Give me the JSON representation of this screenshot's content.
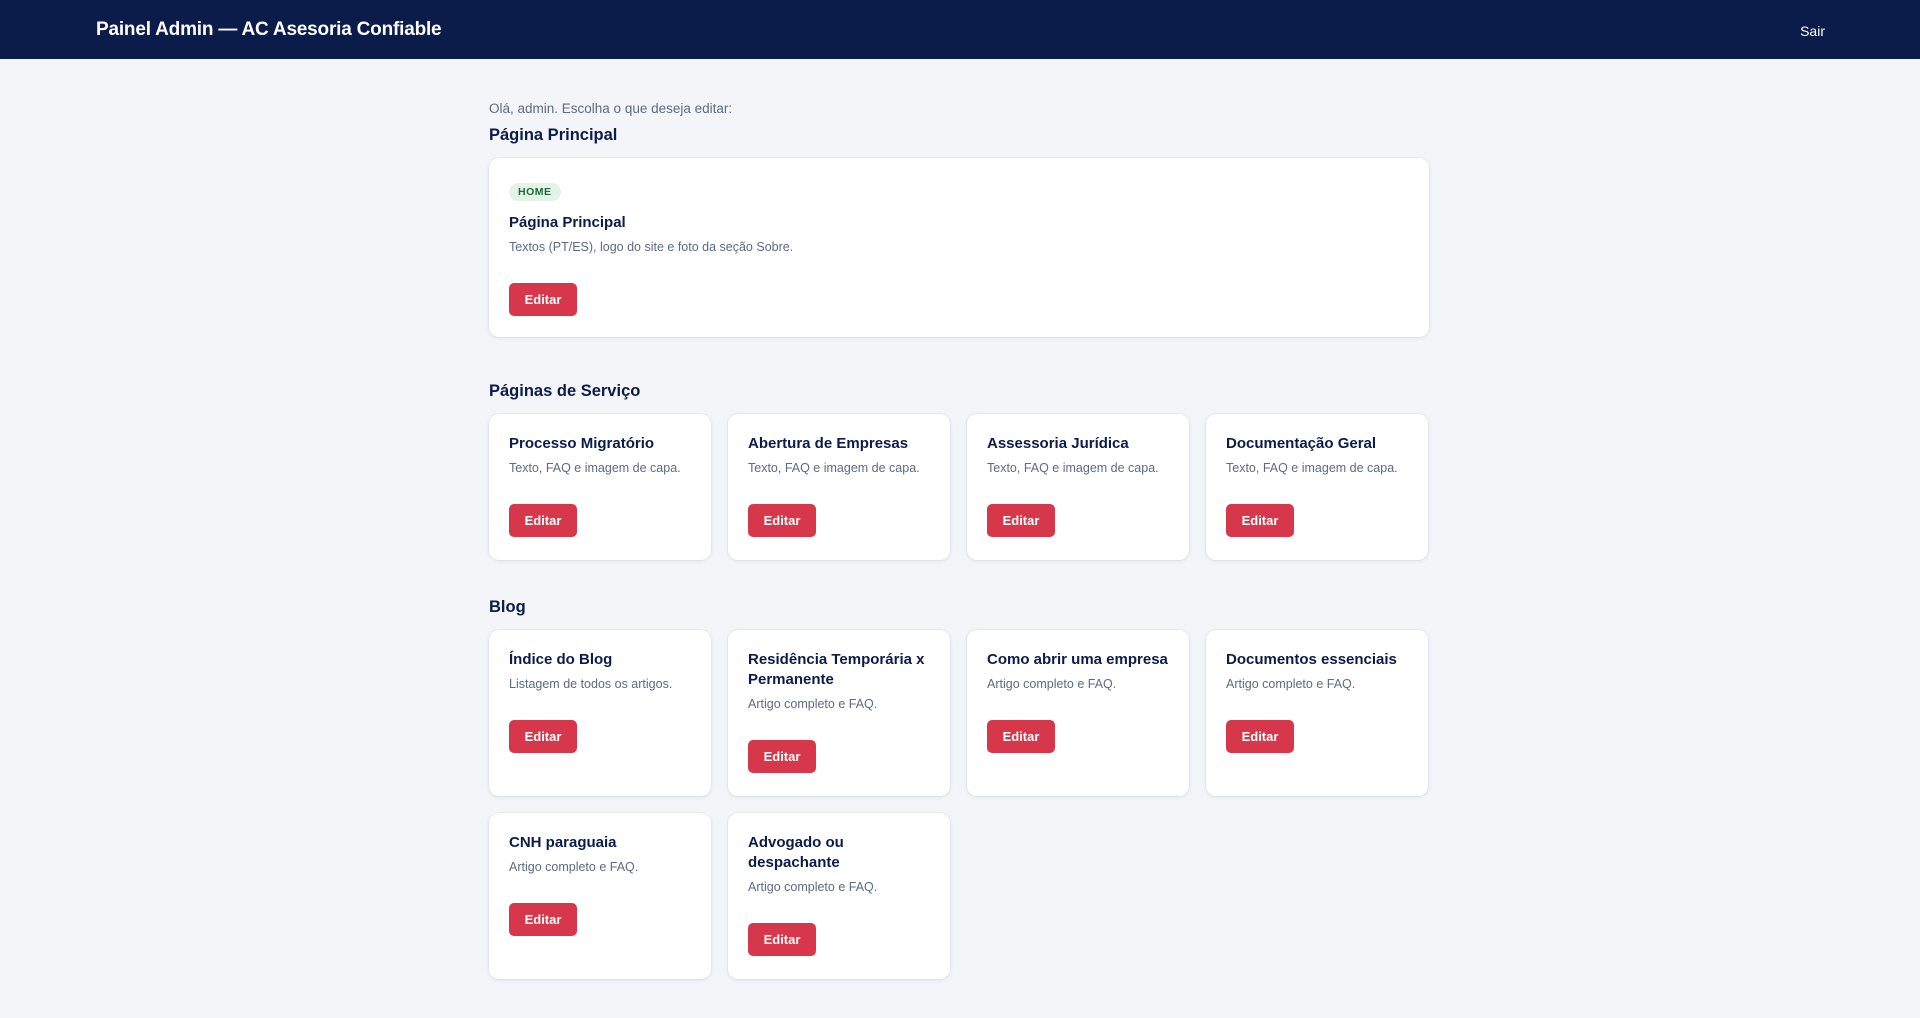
{
  "header": {
    "title": "Painel Admin — AC Asesoria Confiable",
    "logout_label": "Sair"
  },
  "greeting": "Olá, admin. Escolha o que deseja editar:",
  "sections": {
    "home": {
      "title": "Página Principal",
      "card": {
        "badge": "HOME",
        "title": "Página Principal",
        "description": "Textos (PT/ES), logo do site e foto da seção Sobre.",
        "button": "Editar"
      }
    },
    "services": {
      "title": "Páginas de Serviço",
      "cards": [
        {
          "title": "Processo Migratório",
          "description": "Texto, FAQ e imagem de capa.",
          "button": "Editar"
        },
        {
          "title": "Abertura de Empresas",
          "description": "Texto, FAQ e imagem de capa.",
          "button": "Editar"
        },
        {
          "title": "Assessoria Jurídica",
          "description": "Texto, FAQ e imagem de capa.",
          "button": "Editar"
        },
        {
          "title": "Documentação Geral",
          "description": "Texto, FAQ e imagem de capa.",
          "button": "Editar"
        }
      ]
    },
    "blog": {
      "title": "Blog",
      "cards": [
        {
          "title": "Índice do Blog",
          "description": "Listagem de todos os artigos.",
          "button": "Editar"
        },
        {
          "title": "Residência Temporária x Permanente",
          "description": "Artigo completo e FAQ.",
          "button": "Editar"
        },
        {
          "title": "Como abrir uma empresa",
          "description": "Artigo completo e FAQ.",
          "button": "Editar"
        },
        {
          "title": "Documentos essenciais",
          "description": "Artigo completo e FAQ.",
          "button": "Editar"
        },
        {
          "title": "CNH paraguaia",
          "description": "Artigo completo e FAQ.",
          "button": "Editar"
        },
        {
          "title": "Advogado ou despachante",
          "description": "Artigo completo e FAQ.",
          "button": "Editar"
        }
      ]
    }
  },
  "colors": {
    "header_bg": "#0b1c4a",
    "page_bg": "#f3f5f9",
    "accent_button": "#d6374b",
    "badge_bg": "#e3f3e6",
    "badge_text": "#1d6b36"
  }
}
